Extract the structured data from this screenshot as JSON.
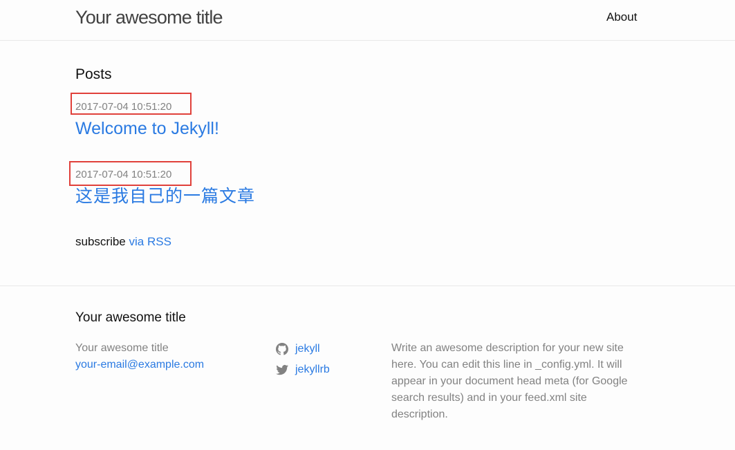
{
  "header": {
    "site_title": "Your awesome title",
    "nav": {
      "about": "About"
    }
  },
  "main": {
    "heading": "Posts",
    "posts": [
      {
        "date": "2017-07-04 10:51:20",
        "title": "Welcome to Jekyll!"
      },
      {
        "date": "2017-07-04 10:51:20",
        "title": "这是我自己的一篇文章"
      }
    ],
    "rss": {
      "prefix": "subscribe",
      "link": "via RSS"
    }
  },
  "footer": {
    "heading": "Your awesome title",
    "contact": {
      "name": "Your awesome title",
      "email": "your-email@example.com"
    },
    "social": [
      {
        "icon": "github-icon",
        "label": "jekyll"
      },
      {
        "icon": "twitter-icon",
        "label": "jekyllrb"
      }
    ],
    "description": "Write an awesome description for your new site here. You can edit this line in _config.yml. It will appear in your document head meta (for Google search results) and in your feed.xml site description."
  },
  "colors": {
    "link": "#2a7ae2",
    "meta": "#828282",
    "highlight_box": "#e0403a"
  }
}
